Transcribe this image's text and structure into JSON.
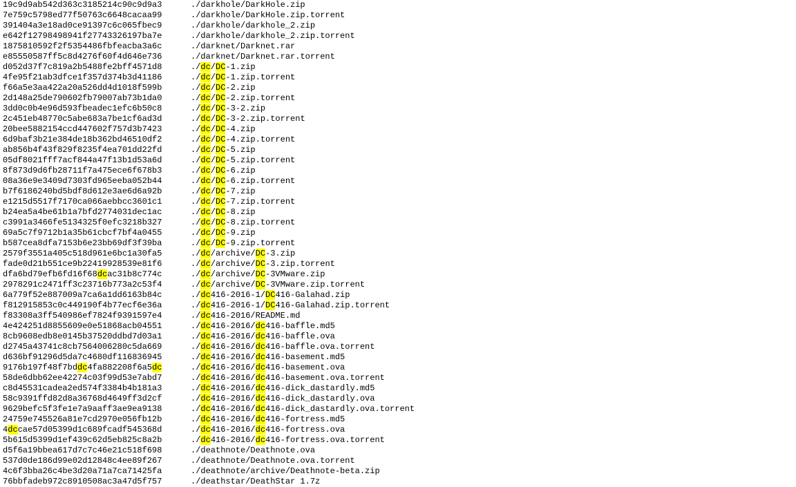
{
  "highlight": "dc",
  "lines": [
    {
      "hash": "19c9d9ab542d363c3185214c90c9d9a3",
      "path": "./darkhole/DarkHole.zip"
    },
    {
      "hash": "7e759c5798ed77f50763c6648cacaa99",
      "path": "./darkhole/DarkHole.zip.torrent"
    },
    {
      "hash": "391404a3e18ad0ce91397c6c065fbec9",
      "path": "./darkhole/darkhole_2.zip"
    },
    {
      "hash": "e642f12798498941f27743326197ba7e",
      "path": "./darkhole/darkhole_2.zip.torrent"
    },
    {
      "hash": "1875810592f2f5354486fbfeacba3a6c",
      "path": "./darknet/Darknet.rar"
    },
    {
      "hash": "e85550587ff5c8d4276f60f4d646e736",
      "path": "./darknet/Darknet.rar.torrent"
    },
    {
      "hash": "d052d37f7c819a2b5488fe2bff4571d8",
      "path": "./dc/DC-1.zip"
    },
    {
      "hash": "4fe95f21ab3dfce1f357d374b3d41186",
      "path": "./dc/DC-1.zip.torrent"
    },
    {
      "hash": "f66a5e3aa422a20a526dd4d1018f599b",
      "path": "./dc/DC-2.zip"
    },
    {
      "hash": "2d148a25de790602fb79007ab73b1da0",
      "path": "./dc/DC-2.zip.torrent"
    },
    {
      "hash": "3dd0c0b4e96d593fbeadec1efc6b50c8",
      "path": "./dc/DC-3-2.zip"
    },
    {
      "hash": "2c451eb48770c5abe683a7be1cf6ad3d",
      "path": "./dc/DC-3-2.zip.torrent"
    },
    {
      "hash": "20bee5882154ccd447602f757d3b7423",
      "path": "./dc/DC-4.zip"
    },
    {
      "hash": "6d9baf3b21e384de18b362bd46510df2",
      "path": "./dc/DC-4.zip.torrent"
    },
    {
      "hash": "ab856b4f43f829f8235f4ea701dd22fd",
      "path": "./dc/DC-5.zip"
    },
    {
      "hash": "05df8021fff7acf844a47f13b1d53a6d",
      "path": "./dc/DC-5.zip.torrent"
    },
    {
      "hash": "8f873d9d6fb28711f7a475ece6f678b3",
      "path": "./dc/DC-6.zip"
    },
    {
      "hash": "08a36e9e3409d7303fd965eeba052b44",
      "path": "./dc/DC-6.zip.torrent"
    },
    {
      "hash": "b7f6186240bd5bdf8d612e3ae6d6a92b",
      "path": "./dc/DC-7.zip"
    },
    {
      "hash": "e1215d5517f7170ca066aebbcc3601c1",
      "path": "./dc/DC-7.zip.torrent"
    },
    {
      "hash": "b24ea5a4be61b1a7bfd2774031dec1ac",
      "path": "./dc/DC-8.zip"
    },
    {
      "hash": "c3991a3466fe5134325f0efc3218b327",
      "path": "./dc/DC-8.zip.torrent"
    },
    {
      "hash": "69a5c7f9712b1a35b61cbcf7bf4a0455",
      "path": "./dc/DC-9.zip"
    },
    {
      "hash": "b587cea8dfa7153b6e23bb69df3f39ba",
      "path": "./dc/DC-9.zip.torrent"
    },
    {
      "hash": "2579f3551a405c518d961e6bc1a30fa5",
      "path": "./dc/archive/DC-3.zip"
    },
    {
      "hash": "fade0d21b551ce9b22419928539e81f6",
      "path": "./dc/archive/DC-3.zip.torrent"
    },
    {
      "hash": "dfa6bd79efb6fd16f68dcac31b8c774c",
      "path": "./dc/archive/DC-3VMware.zip"
    },
    {
      "hash": "2978291c2471ff3c23716b773a2c53f4",
      "path": "./dc/archive/DC-3VMware.zip.torrent"
    },
    {
      "hash": "6a779f52e887009a7ca6a1dd6163b84c",
      "path": "./dc416-2016-1/DC416-Galahad.zip"
    },
    {
      "hash": "f812915853c0c449190f4b77ecf6e36a",
      "path": "./dc416-2016-1/DC416-Galahad.zip.torrent"
    },
    {
      "hash": "f83308a3ff540986ef7824f9391597e4",
      "path": "./dc416-2016/README.md"
    },
    {
      "hash": "4e424251d8855609e0e51868acb04551",
      "path": "./dc416-2016/dc416-baffle.md5"
    },
    {
      "hash": "8cb9608edb8e0145b37520ddbd7d03a1",
      "path": "./dc416-2016/dc416-baffle.ova"
    },
    {
      "hash": "d2745a43741c8cb7564006280c5da669",
      "path": "./dc416-2016/dc416-baffle.ova.torrent"
    },
    {
      "hash": "d636bf91296d5da7c4680df116836945",
      "path": "./dc416-2016/dc416-basement.md5"
    },
    {
      "hash": "9176b197f48f7bddc4fa882208f6a5dc",
      "path": "./dc416-2016/dc416-basement.ova"
    },
    {
      "hash": "58de6dbb62ee42274c03f99d53e7abd7",
      "path": "./dc416-2016/dc416-basement.ova.torrent"
    },
    {
      "hash": "c8d45531cadea2ed574f3384b4b181a3",
      "path": "./dc416-2016/dc416-dick_dastardly.md5"
    },
    {
      "hash": "58c9391ffd82d8a36768d4649ff3d2cf",
      "path": "./dc416-2016/dc416-dick_dastardly.ova"
    },
    {
      "hash": "9629befc5f3fe1e7a9aaff3ae9ea9138",
      "path": "./dc416-2016/dc416-dick_dastardly.ova.torrent"
    },
    {
      "hash": "24759e745526a81e7cd2970e056fb12b",
      "path": "./dc416-2016/dc416-fortress.md5"
    },
    {
      "hash": "4dccae57d05399d1c689fcadf545368d",
      "path": "./dc416-2016/dc416-fortress.ova"
    },
    {
      "hash": "5b615d5399d1ef439c62d5eb825c8a2b",
      "path": "./dc416-2016/dc416-fortress.ova.torrent"
    },
    {
      "hash": "d5f6a19bbea617d7c7c46e21c518f698",
      "path": "./deathnote/Deathnote.ova"
    },
    {
      "hash": "537d0de186d99e02d12848c4ee89f267",
      "path": "./deathnote/Deathnote.ova.torrent"
    },
    {
      "hash": "4c6f3bba26c4be3d20a71a7ca71425fa",
      "path": "./deathnote/archive/Deathnote-beta.zip"
    },
    {
      "hash": "76bbfadeb972c8910508ac3a47d5f757",
      "path": "./deathstar/DeathStar 1.7z"
    }
  ]
}
